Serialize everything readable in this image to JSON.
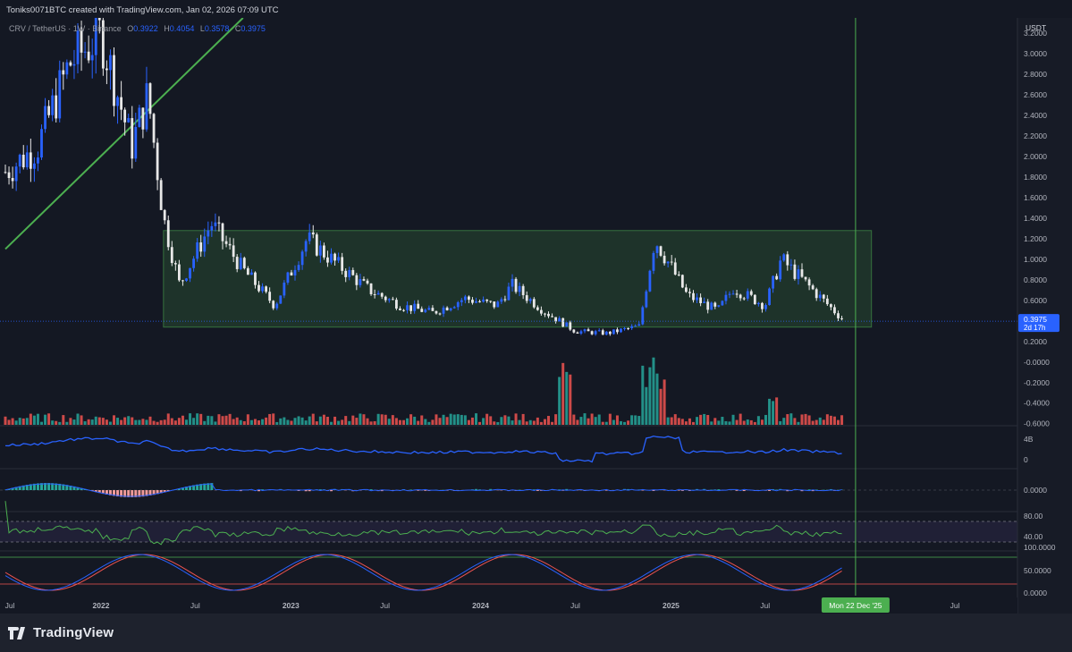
{
  "header": {
    "created_text": "Toniks0071BTC created with TradingView.com, Jan 02, 2026 07:09 UTC"
  },
  "legend": {
    "symbol_text": "CRV / TetherUS · 1W · Binance",
    "open_key": "O",
    "open_val": "0.3922",
    "high_key": "H",
    "high_val": "0.4054",
    "low_key": "L",
    "low_val": "0.3578",
    "close_key": "C",
    "close_val": "0.3975"
  },
  "currency": "USDT",
  "last_price": {
    "value": "0.3975",
    "countdown": "2d 17h"
  },
  "cursor_date": "Mon 22 Dec '25",
  "brand": "TradingView",
  "colors": {
    "background": "#141823",
    "up": "#2962ff",
    "down": "#e8e8e8",
    "trendline": "#4caf50",
    "range_box": "#4caf50",
    "volume_up": "#26a69a",
    "volume_down": "#ef5350",
    "obv_line": "#2962ff",
    "cursor_line": "#4caf50",
    "stoch_k": "#2962ff",
    "stoch_d": "#ef5350"
  },
  "chart_data": {
    "type": "candlestick",
    "timeframe": "1W",
    "x_range": [
      "2021-07",
      "2026-07"
    ],
    "x_ticks": [
      "Jul",
      "2022",
      "Jul",
      "2023",
      "Jul",
      "2024",
      "Jul",
      "2025",
      "Jul",
      "Jul"
    ],
    "y_ticks": [
      "3.2000",
      "3.0000",
      "2.8000",
      "2.6000",
      "2.4000",
      "2.2000",
      "2.0000",
      "1.8000",
      "1.6000",
      "1.4000",
      "1.2000",
      "1.0000",
      "0.8000",
      "0.6000",
      "0.4000",
      "0.2000",
      "-0.0000",
      "-0.2000",
      "-0.4000",
      "-0.6000"
    ],
    "ylim": [
      -0.62,
      3.35
    ],
    "price_path": [
      [
        "2021-07",
        1.85
      ],
      [
        "2021-09",
        2.1
      ],
      [
        "2021-11",
        2.9
      ],
      [
        "2022-01",
        3.2
      ],
      [
        "2022-03",
        2.1
      ],
      [
        "2022-04",
        2.6
      ],
      [
        "2022-05",
        1.4
      ],
      [
        "2022-06",
        0.75
      ],
      [
        "2022-08",
        1.35
      ],
      [
        "2022-10",
        0.9
      ],
      [
        "2022-12",
        0.55
      ],
      [
        "2023-02",
        1.2
      ],
      [
        "2023-04",
        0.95
      ],
      [
        "2023-06",
        0.7
      ],
      [
        "2023-08",
        0.55
      ],
      [
        "2023-10",
        0.48
      ],
      [
        "2023-12",
        0.62
      ],
      [
        "2024-02",
        0.55
      ],
      [
        "2024-03",
        0.75
      ],
      [
        "2024-05",
        0.5
      ],
      [
        "2024-07",
        0.3
      ],
      [
        "2024-09",
        0.28
      ],
      [
        "2024-11",
        0.35
      ],
      [
        "2024-12",
        1.2
      ],
      [
        "2025-02",
        0.65
      ],
      [
        "2025-04",
        0.5
      ],
      [
        "2025-05",
        0.72
      ],
      [
        "2025-07",
        0.55
      ],
      [
        "2025-08",
        1.0
      ],
      [
        "2025-10",
        0.7
      ],
      [
        "2025-12",
        0.3975
      ]
    ],
    "annotations": {
      "trendline": {
        "start": [
          "2021-07",
          1.1
        ],
        "end": [
          "2022-10",
          3.35
        ]
      },
      "range_box": {
        "start": "2022-05",
        "end": "2025-12",
        "top": 1.28,
        "bottom": 0.34
      }
    },
    "panes": [
      {
        "name": "Volume",
        "ticks": []
      },
      {
        "name": "OBV",
        "ticks": [
          "4B",
          "0"
        ]
      },
      {
        "name": "MACD",
        "ticks": [
          "0.0000"
        ]
      },
      {
        "name": "RSI",
        "ticks": [
          "80.00",
          "40.00"
        ]
      },
      {
        "name": "Stoch",
        "ticks": [
          "100.0000",
          "50.0000",
          "0.0000"
        ]
      }
    ]
  }
}
